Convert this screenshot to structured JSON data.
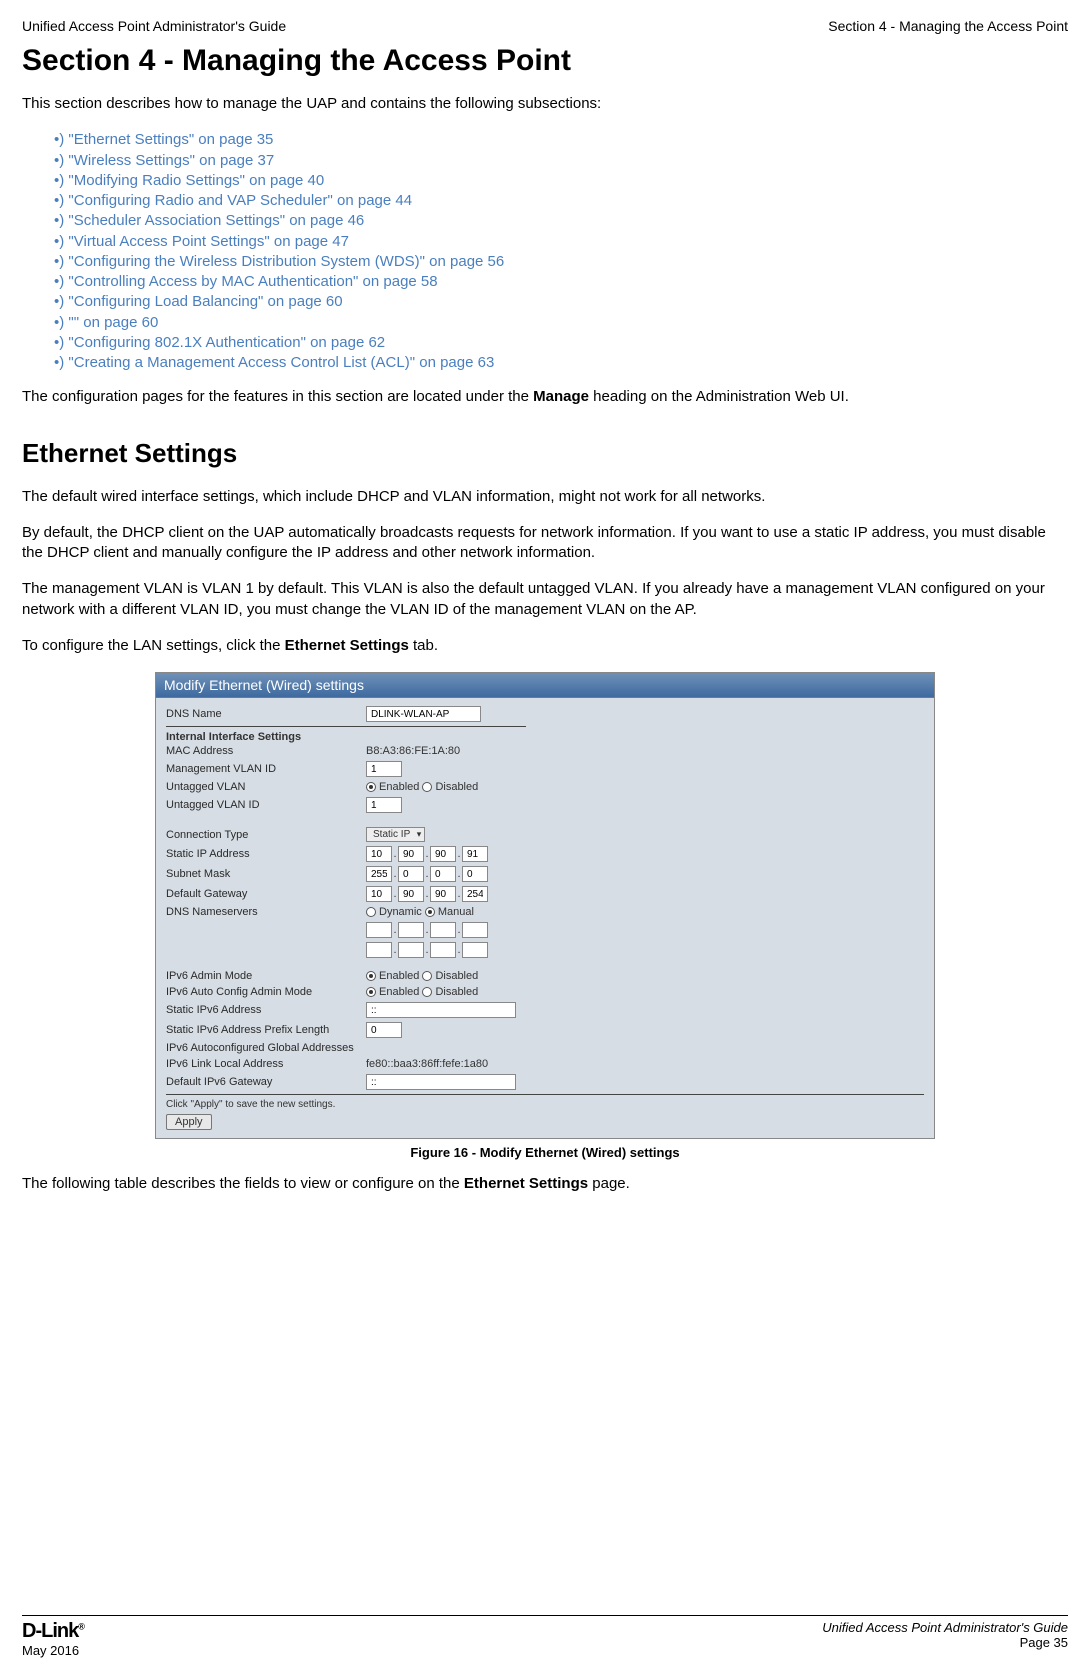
{
  "header": {
    "left": "Unified Access Point Administrator's Guide",
    "right": "Section 4 - Managing the Access Point"
  },
  "title": "Section 4 - Managing the Access Point",
  "intro": "This section describes how to manage the UAP and contains the following subsections:",
  "toc": [
    "\"Ethernet Settings\" on page 35",
    "\"Wireless Settings\" on page 37",
    "\"Modifying Radio Settings\" on page 40",
    "\"Configuring Radio and VAP Scheduler\" on page 44",
    "\"Scheduler Association Settings\" on page 46",
    "\"Virtual Access Point Settings\" on page 47",
    "\"Configuring the Wireless Distribution System (WDS)\" on page 56",
    "\"Controlling Access by MAC Authentication\" on page 58",
    "\"Configuring Load Balancing\" on page 60",
    "\"\" on page 60",
    "\"Configuring 802.1X Authentication\" on page 62",
    "\"Creating a Management Access Control List (ACL)\" on page 63"
  ],
  "p_config_pages_a": "The configuration pages for the features in this section are located under the ",
  "p_config_pages_b": "Manage",
  "p_config_pages_c": " heading on the Administration Web UI.",
  "h2": "Ethernet Settings",
  "p1": "The default wired interface settings, which include DHCP and VLAN information, might not work for all networks.",
  "p2": "By default, the DHCP client on the UAP automatically broadcasts requests for network information. If you want to use a static IP address, you must disable the DHCP client and manually configure the IP address and other network information.",
  "p3": "The management VLAN is VLAN 1 by default. This VLAN is also the default untagged VLAN. If you already have a management VLAN configured on your network with a different VLAN ID, you must change the VLAN ID of the management VLAN on the AP.",
  "p4a": "To configure the LAN settings, click the ",
  "p4b": "Ethernet Settings",
  "p4c": " tab.",
  "figure": {
    "titlebar": "Modify Ethernet (Wired) settings",
    "rows": {
      "dns_name_label": "DNS Name",
      "dns_name_value": "DLINK-WLAN-AP",
      "internal_head": "Internal Interface Settings",
      "mac_label": "MAC Address",
      "mac_value": "B8:A3:86:FE:1A:80",
      "mgmt_vlan_label": "Management VLAN ID",
      "mgmt_vlan_value": "1",
      "untagged_vlan_label": "Untagged VLAN",
      "untagged_vlan_id_label": "Untagged VLAN ID",
      "untagged_vlan_id_value": "1",
      "conn_type_label": "Connection Type",
      "conn_type_value": "Static IP",
      "static_ip_label": "Static IP Address",
      "static_ip": [
        "10",
        "90",
        "90",
        "91"
      ],
      "subnet_label": "Subnet Mask",
      "subnet": [
        "255",
        "0",
        "0",
        "0"
      ],
      "gateway_label": "Default Gateway",
      "gateway": [
        "10",
        "90",
        "90",
        "254"
      ],
      "dns_servers_label": "DNS Nameservers",
      "dns_dynamic": "Dynamic",
      "dns_manual": "Manual",
      "ipv6_admin_label": "IPv6 Admin Mode",
      "ipv6_auto_label": "IPv6 Auto Config Admin Mode",
      "static_ipv6_label": "Static IPv6 Address",
      "static_ipv6_value": "::",
      "ipv6_prefix_label": "Static IPv6 Address Prefix Length",
      "ipv6_prefix_value": "0",
      "ipv6_autoconf_label": "IPv6 Autoconfigured Global Addresses",
      "ipv6_linklocal_label": "IPv6 Link Local Address",
      "ipv6_linklocal_value": "fe80::baa3:86ff:fefe:1a80",
      "default_ipv6_gw_label": "Default IPv6 Gateway",
      "default_ipv6_gw_value": "::",
      "enabled": "Enabled",
      "disabled": "Disabled",
      "apply_hint": "Click \"Apply\" to save the new settings.",
      "apply_btn": "Apply"
    },
    "caption": "Figure 16 - Modify Ethernet (Wired) settings"
  },
  "p5a": "The following table describes the fields to view or configure on the ",
  "p5b": "Ethernet Settings",
  "p5c": " page.",
  "footer": {
    "logo": "D-Link",
    "date": "May 2016",
    "right1": "Unified Access Point Administrator's Guide",
    "right2": "Page 35"
  }
}
